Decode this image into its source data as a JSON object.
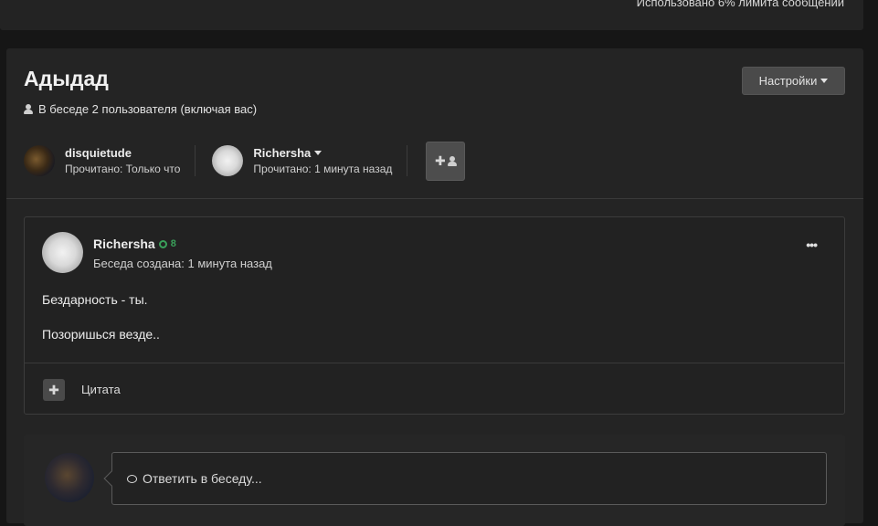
{
  "top": {
    "usage_text": "Использовано 6% лимита сообщений"
  },
  "conversation": {
    "title": "Адыдад",
    "members_text": "В беседе 2 пользователя (включая вас)",
    "settings_label": "Настройки",
    "participants": [
      {
        "name": "disquietude",
        "read": "Прочитано: Только что"
      },
      {
        "name": "Richersha",
        "read": "Прочитано: 1 минута назад"
      }
    ]
  },
  "message": {
    "author": "Richersha",
    "reputation": "8",
    "meta": "Беседа создана: 1 минута назад",
    "menu_glyph": "•••",
    "lines": [
      "Бездарность - ты.",
      "Позоришься везде.."
    ],
    "quote_label": "Цитата"
  },
  "reply": {
    "placeholder": "Ответить в беседу..."
  },
  "icons": {
    "plus": "✚",
    "member_add": "user-plus-icon"
  },
  "colors": {
    "accent_rep": "#3aa05a",
    "panel": "#242424",
    "page": "#161616"
  }
}
